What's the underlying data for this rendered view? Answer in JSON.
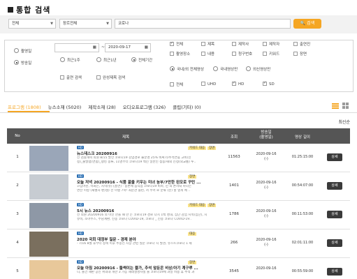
{
  "page": {
    "title": "통합 검색"
  },
  "search": {
    "scope": "전체",
    "genre": "장르전체",
    "query": "코로나",
    "button": "검색"
  },
  "filter": {
    "date_type": [
      {
        "label": "촬영일",
        "selected": false
      },
      {
        "label": "방송일",
        "selected": true
      }
    ],
    "date_from": "",
    "date_to": "2020-09-17",
    "period": [
      {
        "label": "최근1주",
        "selected": false
      },
      {
        "label": "최근1년",
        "selected": false
      },
      {
        "label": "전체기간",
        "selected": true
      }
    ],
    "extra": [
      {
        "label": "출연 검색",
        "checked": false
      },
      {
        "label": "완성제목 검색",
        "checked": false
      }
    ],
    "fields_row1": [
      {
        "label": "전체",
        "checked": true
      },
      {
        "label": "제목",
        "checked": false
      },
      {
        "label": "제작사",
        "checked": false
      },
      {
        "label": "제작자",
        "checked": false
      },
      {
        "label": "출연진",
        "checked": false
      }
    ],
    "fields_row2": [
      {
        "label": "촬영장소",
        "checked": false
      },
      {
        "label": "내용",
        "checked": false
      },
      {
        "label": "청구번호",
        "checked": false
      },
      {
        "label": "키워드",
        "checked": false
      },
      {
        "label": "장면",
        "checked": false
      }
    ],
    "video_type": [
      {
        "label": "국내/외 전체영상",
        "selected": true
      },
      {
        "label": "국내영상만",
        "selected": false
      },
      {
        "label": "외신영상만",
        "selected": false
      }
    ],
    "resolution": [
      {
        "label": "전체",
        "checked": false
      },
      {
        "label": "UHD",
        "checked": false
      },
      {
        "label": "HD",
        "checked": true
      },
      {
        "label": "SD",
        "checked": true
      }
    ]
  },
  "tabs": [
    {
      "label": "프로그램 (1808)",
      "active": true
    },
    {
      "label": "뉴스소재 (5020)",
      "active": false
    },
    {
      "label": "제작소재 (28)",
      "active": false
    },
    {
      "label": "오디오프로그램 (326)",
      "active": false
    },
    {
      "label": "클립(기타) (0)",
      "active": false
    }
  ],
  "sort_label": "최신순",
  "table": {
    "headers": [
      "No",
      "제목",
      "조회",
      "방송일\n(촬영일)",
      "영상 길이",
      ""
    ],
    "detail_label": "상세",
    "rows": [
      {
        "no": "1",
        "badge": "HD",
        "title": "뉴스데스크 20200916",
        "snip1": "전 검찰개혁 의원 8/15 발언 코로나19 감염경로 불분명 25% 비싸기/추석연휴 고비(신",
        "snip2": "청)_출발맵(연합)_랭킹 종류, 11명부터 코로나19 백신 일반인 접종/해외 신청(외교통) 투..",
        "tags": [
          "키워드 대응",
          "장면"
        ],
        "views": "11563",
        "date": "2020-09-16",
        "date2": "(-)",
        "length": "01:25:15:00",
        "thumb": "#9aa6b8"
      },
      {
        "no": "2",
        "badge": "HD",
        "title": "오늘 저녁 20200916 - 식품 꿀을 키우는 미녀 농부/7만한 된모로 꾸민 ...",
        "snip1": "코심어린, 이화는, 지역(유) [흡연] - 농촌에 음식점 코로나19 비파, 민 의 촌자락 마나는",
        "snip2": "면산 이방 (재벌차 편)설) 전 이행 7학! 최문관 블런, 저 주어 로 분류 (분) 할 열게 메 ..",
        "tags": [
          "장면"
        ],
        "views": "1401",
        "date": "2020-09-16",
        "date2": "(-)",
        "length": "00:54:07:00",
        "thumb": "#c7ccd2"
      },
      {
        "no": "3",
        "badge": "HD",
        "title": "5시 뉴스 20200916",
        "snip1": "전 의원 20200916 의 이인 한을 때 한 는 코로나19 경로 다시 1백 명대, 집단 감염 지속(집단), 시",
        "snip2": "유비, 소아주스, 주담계환, 신종 코로나 COVID-19, 코로나 _ 신종 코로나 COVID-19..",
        "tags": [
          "키워드 대응",
          "장면"
        ],
        "views": "1786",
        "date": "2020-09-16",
        "date2": "(-)",
        "length": "00:11:53:00",
        "thumb": "#8e98a6"
      },
      {
        "no": "4",
        "badge": "HD",
        "title": "2020 국회 대정부 질문 - 경제 분야",
        "snip1": "- 7/16 8월 후부터 정책 이후 추종신 시장 관련 질문 코로나 시 발견, 유스트코로나 1 세",
        "snip2": "",
        "tags": [
          "대응"
        ],
        "views": "266",
        "date": "2020-09-16",
        "date2": "(-)",
        "length": "02:01:11:00",
        "thumb": "#7a6f5e"
      },
      {
        "no": "5",
        "badge": "HD",
        "title": "오늘 아침 20200916 - 들썩이는 물가, 추석 앞둔은 비상/아기 계구루 ...",
        "snip1": "니, 물건 재판 공인 위의대 개한 3 가능 재래설명사실 물 코로나19에 과일 비용 휴 추적 과",
        "snip2": "",
        "tags": [
          "장면"
        ],
        "views": "3545",
        "date": "2020-09-16",
        "date2": "",
        "length": "00:55:59:00",
        "thumb": "#e8c89a"
      }
    ]
  },
  "colors": {
    "accent": "#f5a623",
    "header_bg": "#555555",
    "badge": "#2a6fb3",
    "highlight": "#fbe48a"
  }
}
